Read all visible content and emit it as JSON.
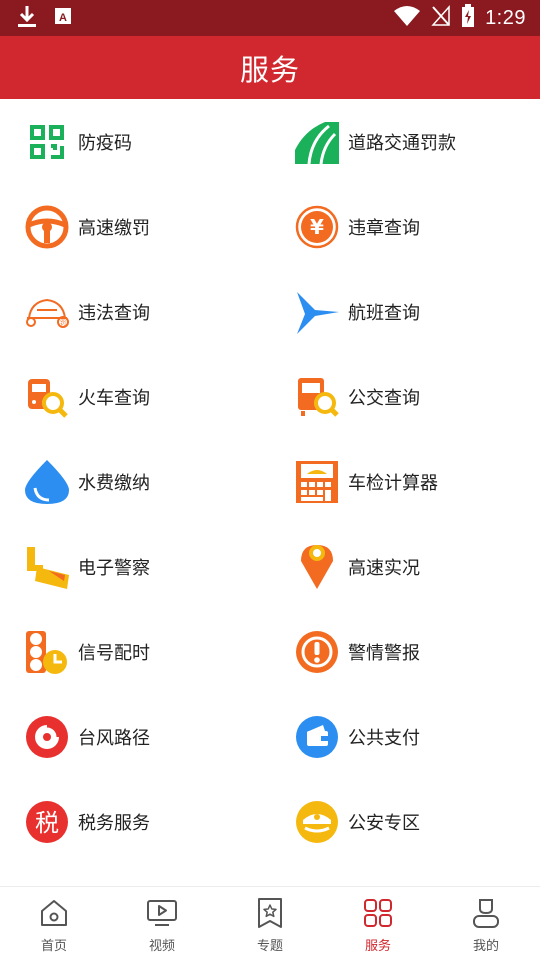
{
  "status": {
    "time": "1:29"
  },
  "header": {
    "title": "服务"
  },
  "services": [
    {
      "label": "防疫码",
      "icon": "qr-code-icon"
    },
    {
      "label": "道路交通罚款",
      "icon": "road-icon"
    },
    {
      "label": "高速缴罚",
      "icon": "steering-wheel-icon"
    },
    {
      "label": "违章查询",
      "icon": "yuan-coin-icon"
    },
    {
      "label": "违法查询",
      "icon": "car-icon"
    },
    {
      "label": "航班查询",
      "icon": "airplane-icon"
    },
    {
      "label": "火车查询",
      "icon": "train-search-icon"
    },
    {
      "label": "公交查询",
      "icon": "bus-search-icon"
    },
    {
      "label": "水费缴纳",
      "icon": "water-drop-icon"
    },
    {
      "label": "车检计算器",
      "icon": "calculator-icon"
    },
    {
      "label": "电子警察",
      "icon": "traffic-camera-icon"
    },
    {
      "label": "高速实况",
      "icon": "location-pin-icon"
    },
    {
      "label": "信号配时",
      "icon": "traffic-light-icon"
    },
    {
      "label": "警情警报",
      "icon": "alert-icon"
    },
    {
      "label": "台风路径",
      "icon": "typhoon-icon"
    },
    {
      "label": "公共支付",
      "icon": "wallet-icon"
    },
    {
      "label": "税务服务",
      "icon": "tax-icon"
    },
    {
      "label": "公安专区",
      "icon": "police-cap-icon"
    }
  ],
  "nav": [
    {
      "label": "首页",
      "icon": "home-icon"
    },
    {
      "label": "视频",
      "icon": "video-icon"
    },
    {
      "label": "专题",
      "icon": "bookmark-icon"
    },
    {
      "label": "服务",
      "icon": "grid-icon"
    },
    {
      "label": "我的",
      "icon": "user-icon"
    }
  ],
  "colors": {
    "header": "#d0282e",
    "status_bar": "#8a1a20",
    "accent_orange": "#f26b21",
    "accent_blue": "#2b8ef0",
    "accent_green": "#1bb05a",
    "accent_red": "#e8312f",
    "accent_yellow": "#f5b80f"
  }
}
